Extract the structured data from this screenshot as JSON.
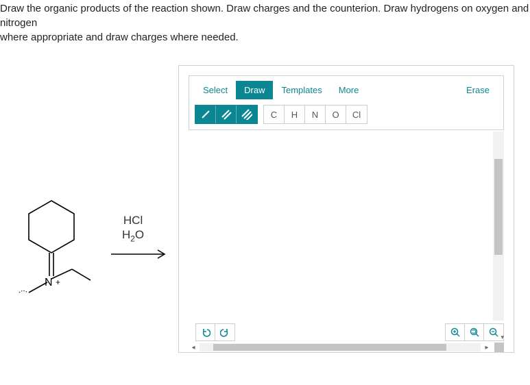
{
  "prompt": {
    "line1": "Draw the organic products of the reaction shown. Draw charges and the counterion. Draw hydrogens on oxygen and nitrogen",
    "line2": "where appropriate and draw charges where needed."
  },
  "reagent": {
    "line1": "HCl",
    "line2_html": "H<sub>2</sub>O"
  },
  "tabs": {
    "select": "Select",
    "draw": "Draw",
    "templates": "Templates",
    "more": "More",
    "erase": "Erase"
  },
  "atoms": [
    "C",
    "H",
    "N",
    "O",
    "Cl"
  ],
  "bond_icons": [
    "single",
    "double",
    "triple"
  ],
  "undo": {
    "undo": "↶",
    "redo": "↷"
  },
  "zoom": {
    "in": "⊕",
    "reset": "⟲",
    "out": "⊖"
  },
  "scroll": {
    "left": "◂",
    "right": "▸",
    "down": "▾"
  },
  "colors": {
    "accent": "#0b8793",
    "border": "#d0d0d0"
  }
}
